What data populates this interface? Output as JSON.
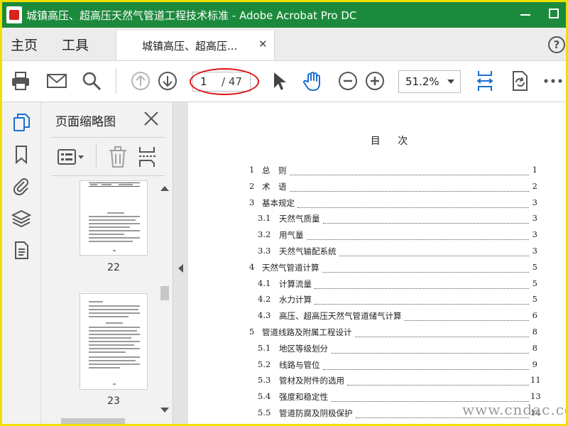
{
  "window": {
    "title": "城镇高压、超高压天然气管道工程技术标准 - Adobe Acrobat Pro DC"
  },
  "tabs": {
    "home": "主页",
    "tools": "工具",
    "document": "城镇高压、超高压...",
    "help": "?"
  },
  "toolbar": {
    "icons": [
      "print-icon",
      "email-icon",
      "search-icon",
      "page-up-icon",
      "page-down-icon",
      "select-cursor-icon",
      "hand-tool-icon",
      "zoom-out-icon",
      "zoom-in-icon",
      "fit-width-icon",
      "rotate-page-icon",
      "more-icon"
    ],
    "page_current": "1",
    "page_total": "/ 47",
    "zoom": "51.2%"
  },
  "sidebar": {
    "icons": [
      "page-thumbnails-icon",
      "bookmark-icon",
      "attachment-icon",
      "layers-icon",
      "document-properties-icon"
    ]
  },
  "thumbnail_panel": {
    "title": "页面缩略图",
    "thumbnails": [
      {
        "label": "22"
      },
      {
        "label": "23"
      }
    ]
  },
  "toc": {
    "title": "目 次",
    "rows": [
      {
        "num": "1",
        "text": "总　则",
        "page": "1",
        "indent": false
      },
      {
        "num": "2",
        "text": "术　语",
        "page": "2",
        "indent": false
      },
      {
        "num": "3",
        "text": "基本规定",
        "page": "3",
        "indent": false
      },
      {
        "num": "3.1",
        "text": "天然气质量",
        "page": "3",
        "indent": true
      },
      {
        "num": "3.2",
        "text": "用气量",
        "page": "3",
        "indent": true
      },
      {
        "num": "3.3",
        "text": "天然气输配系统",
        "page": "3",
        "indent": true
      },
      {
        "num": "4",
        "text": "天然气管道计算",
        "page": "5",
        "indent": false
      },
      {
        "num": "4.1",
        "text": "计算流量",
        "page": "5",
        "indent": true
      },
      {
        "num": "4.2",
        "text": "水力计算",
        "page": "5",
        "indent": true
      },
      {
        "num": "4.3",
        "text": "高压、超高压天然气管道储气计算",
        "page": "6",
        "indent": true
      },
      {
        "num": "5",
        "text": "管道线路及附属工程设计",
        "page": "8",
        "indent": false
      },
      {
        "num": "5.1",
        "text": "地区等级划分",
        "page": "8",
        "indent": true
      },
      {
        "num": "5.2",
        "text": "线路与管位",
        "page": "9",
        "indent": true
      },
      {
        "num": "5.3",
        "text": "管材及附件的选用",
        "page": "11",
        "indent": true
      },
      {
        "num": "5.4",
        "text": "强度和稳定性",
        "page": "13",
        "indent": true
      },
      {
        "num": "5.5",
        "text": "管道防腐及阴极保护",
        "page": "14",
        "indent": true
      }
    ]
  },
  "watermark": "www.cndac.com"
}
